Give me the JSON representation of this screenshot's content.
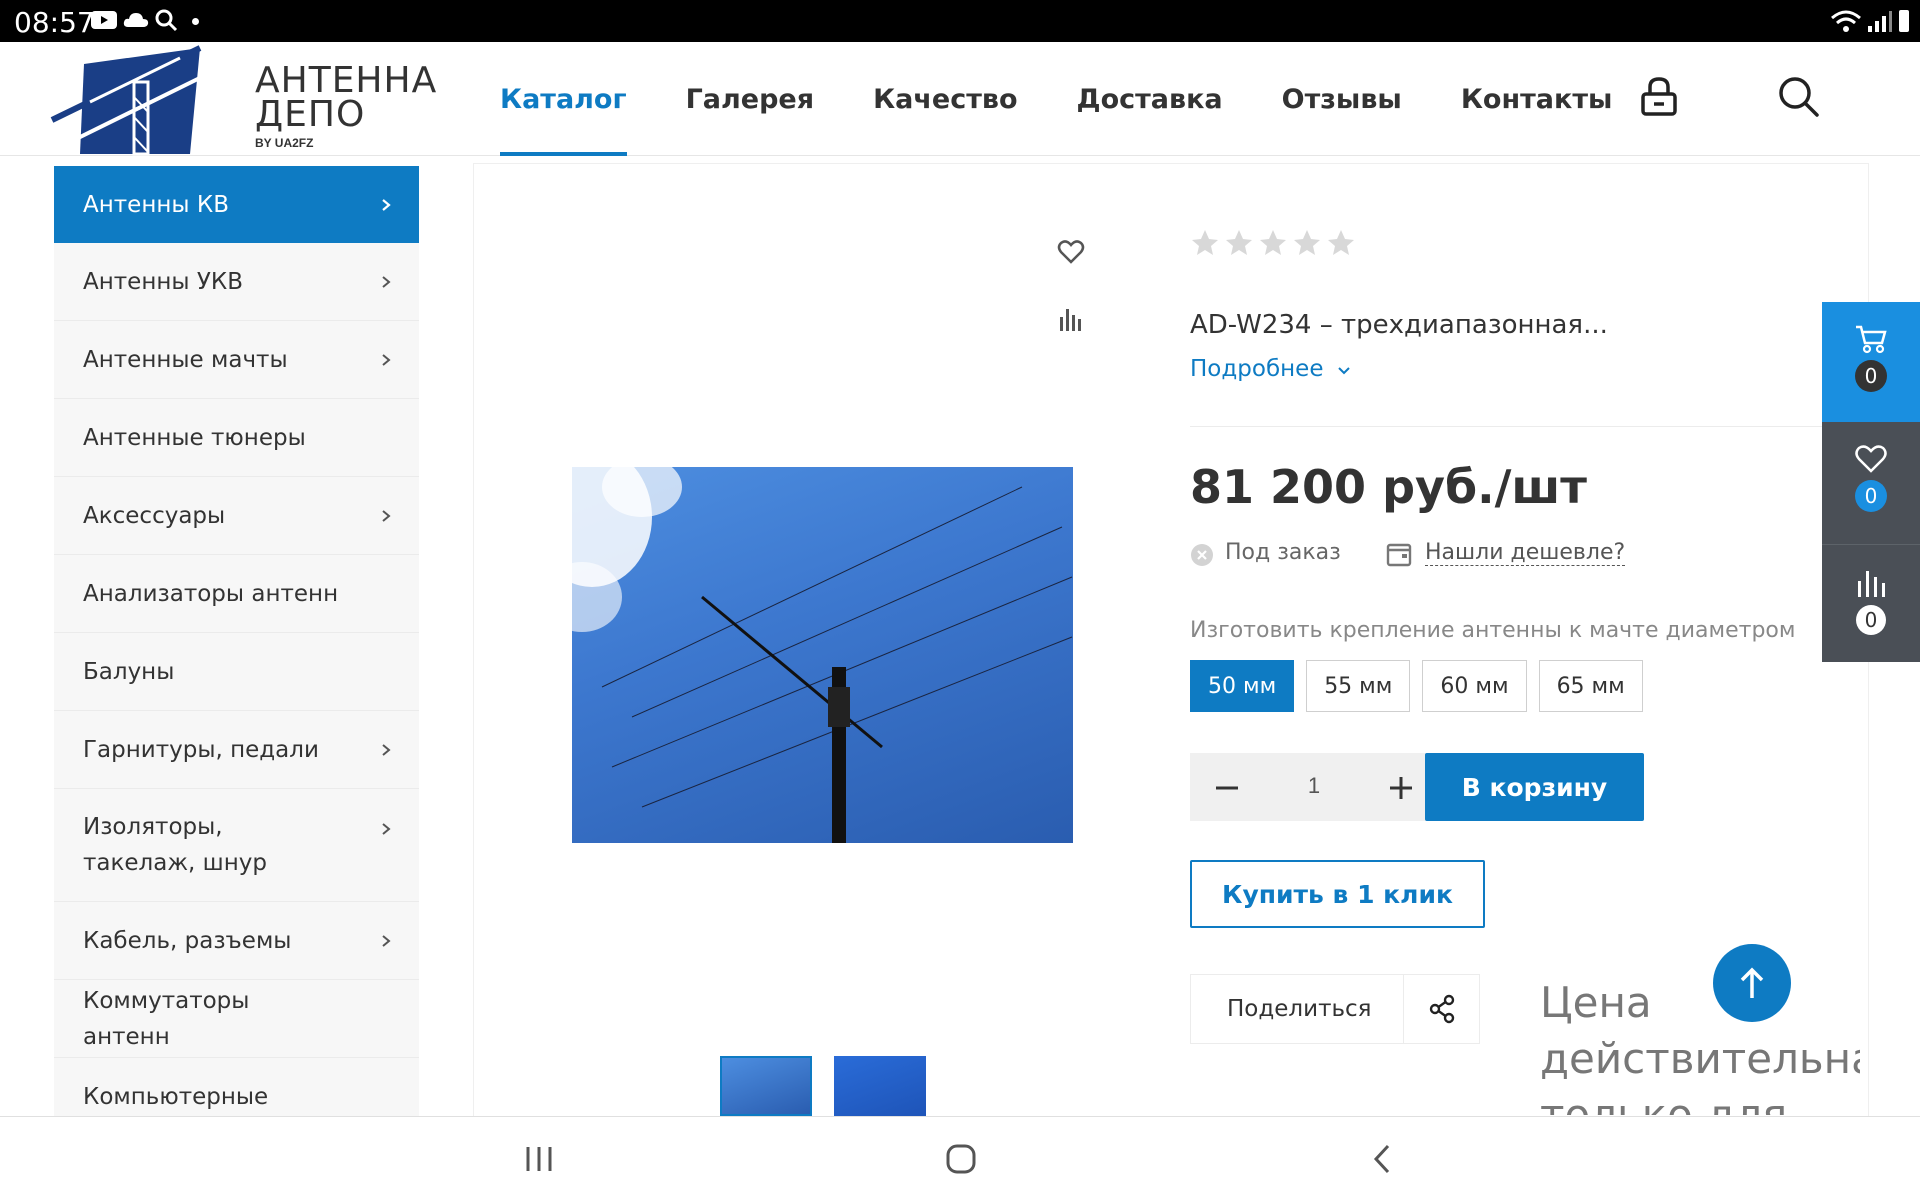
{
  "status_bar": {
    "time": "08:57"
  },
  "header": {
    "logo": {
      "line1": "АНТЕННА",
      "line2": "ДЕПО",
      "line3": "BY UA2FZ"
    },
    "nav": [
      "Каталог",
      "Галерея",
      "Качество",
      "Доставка",
      "Отзывы",
      "Контакты"
    ],
    "active_nav": "Каталог"
  },
  "sidebar": {
    "items": [
      {
        "label": "Антенны КВ",
        "has_submenu": true,
        "active": true
      },
      {
        "label": "Антенны УКВ",
        "has_submenu": true
      },
      {
        "label": "Антенные мачты",
        "has_submenu": true
      },
      {
        "label": "Антенные тюнеры",
        "has_submenu": false
      },
      {
        "label": "Аксессуары",
        "has_submenu": true
      },
      {
        "label": "Анализаторы антенн",
        "has_submenu": false
      },
      {
        "label": "Балуны",
        "has_submenu": false
      },
      {
        "label": "Гарнитуры, педали",
        "has_submenu": true
      },
      {
        "label": "Изоляторы, такелаж, шнур",
        "has_submenu": true
      },
      {
        "label": "Кабель, разъемы",
        "has_submenu": true
      },
      {
        "label": "Коммутаторы антенн",
        "has_submenu": false
      },
      {
        "label": "Компьютерные",
        "has_submenu": false
      }
    ]
  },
  "product": {
    "rating_stars": 5,
    "rating_value": 0,
    "title": "AD-W234 – трехдиапазонная...",
    "more_link": "Подробнее",
    "price": "81 200 руб./шт",
    "stock_status": "Под заказ",
    "cheaper_link": "Нашли дешевле?",
    "option_label": "Изготовить крепление антенны к мачте диаметром",
    "sizes": [
      "50 мм",
      "55 мм",
      "60 мм",
      "65 мм"
    ],
    "selected_size": "50 мм",
    "quantity": "1",
    "add_to_cart": "В корзину",
    "buy_one_click": "Купить в 1 клик",
    "share": "Поделиться",
    "price_note": "Цена действительна только для"
  },
  "floating_panel": {
    "cart_count": "0",
    "favorites_count": "0",
    "compare_count": "0"
  },
  "colors": {
    "accent": "#0e7bc3",
    "cart_panel": "#1a8fe0",
    "panel_dark": "#4a4f56"
  }
}
